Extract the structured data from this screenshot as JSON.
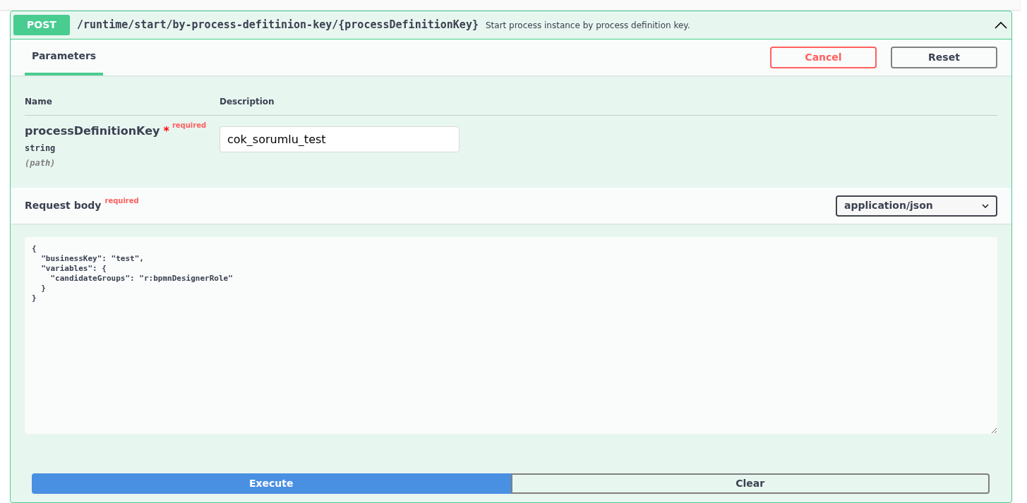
{
  "operation": {
    "method": "POST",
    "path": "/runtime/start/by-process-defitinion-key/{processDefinitionKey}",
    "summary": "Start process instance by process definition key.",
    "expanded": true
  },
  "tabs": [
    {
      "label": "Parameters",
      "selected": true
    }
  ],
  "header_buttons": [
    {
      "label": "Cancel",
      "kind": "cancel"
    },
    {
      "label": "Reset",
      "kind": "reset"
    }
  ],
  "parameters": {
    "columns": [
      "Name",
      "Description"
    ],
    "rows": [
      {
        "name": "processDefinitionKey",
        "required_mark": "*",
        "required_label": "required",
        "type": "string",
        "location": "(path)",
        "value": "cok_sorumlu_test"
      }
    ]
  },
  "request_body": {
    "title": "Request body",
    "required_label": "required",
    "content_type": "application/json",
    "value": "{\n  \"businessKey\": \"test\",\n  \"variables\": {\n    \"candidateGroups\": \"r:bpmnDesignerRole\"\n  }\n}"
  },
  "action_buttons": [
    {
      "label": "Execute",
      "kind": "execute"
    },
    {
      "label": "Clear",
      "kind": "clear"
    }
  ]
}
